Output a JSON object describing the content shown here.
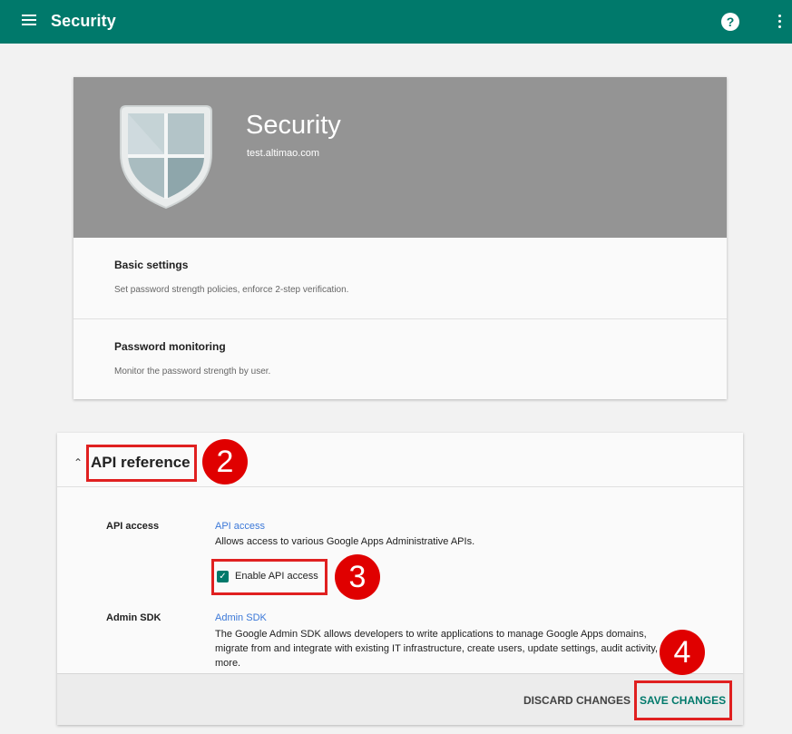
{
  "topbar": {
    "title": "Security",
    "help_icon": "help-icon",
    "more_icon": "more-vert-icon",
    "color": "#00796b"
  },
  "hero": {
    "title": "Security",
    "subtitle": "test.altimao.com",
    "icon": "shield-icon"
  },
  "settings": [
    {
      "title": "Basic settings",
      "description": "Set password strength policies, enforce 2-step verification."
    },
    {
      "title": "Password monitoring",
      "description": "Monitor the password strength by user."
    }
  ],
  "api_section": {
    "title": "API reference",
    "rows": [
      {
        "label": "API access",
        "link": "API access",
        "description": "Allows access to various Google Apps Administrative APIs."
      },
      {
        "label": "Admin SDK",
        "link": "Admin SDK",
        "description": "The Google Admin SDK allows developers to write applications to manage Google Apps domains, migrate from and integrate with existing IT infrastructure, create users, update settings, audit activity, and more."
      }
    ],
    "checkbox": {
      "label": "Enable API access",
      "checked": true
    }
  },
  "footer": {
    "discard_label": "DISCARD CHANGES",
    "save_label": "SAVE CHANGES"
  },
  "annotations": {
    "badge_2": "2",
    "badge_3": "3",
    "badge_4": "4",
    "highlight_color": "#e02020"
  }
}
